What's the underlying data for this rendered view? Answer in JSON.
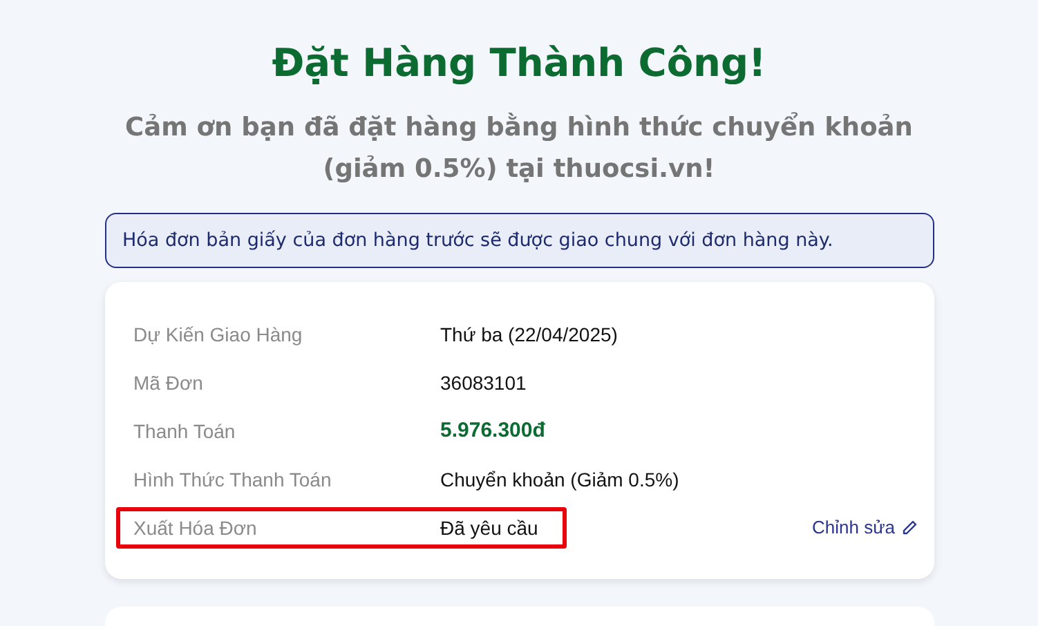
{
  "title": "Đặt Hàng Thành Công!",
  "subtitle": "Cảm ơn bạn đã đặt hàng bằng hình thức chuyển khoản (giảm 0.5%) tại thuocsi.vn!",
  "notice": "Hóa đơn bản giấy của đơn hàng trước sẽ được giao chung với đơn hàng này.",
  "details": [
    {
      "label": "Dự Kiến Giao Hàng",
      "value": "Thứ ba (22/04/2025)",
      "kind": "text",
      "highlighted": false
    },
    {
      "label": "Mã Đơn",
      "value": "36083101",
      "kind": "text",
      "highlighted": false
    },
    {
      "label": "Thanh Toán",
      "value": "5.976.300đ",
      "kind": "price",
      "highlighted": false
    },
    {
      "label": "Hình Thức Thanh Toán",
      "value": "Chuyển khoản (Giảm 0.5%)",
      "kind": "text",
      "highlighted": false
    },
    {
      "label": "Xuất Hóa Đơn",
      "value": "Đã yêu cầu",
      "kind": "text",
      "highlighted": true,
      "action": "Chỉnh sửa"
    }
  ]
}
